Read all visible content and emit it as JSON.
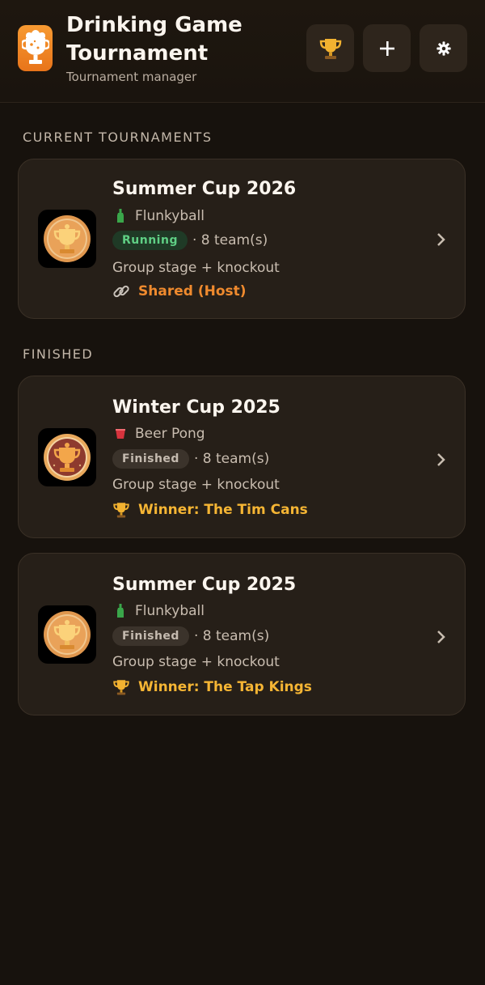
{
  "header": {
    "title": "Drinking Game Tournament",
    "subtitle": "Tournament manager",
    "icons": {
      "app": "beer-trophy-icon",
      "trophy": "trophy-icon",
      "add": "plus-icon",
      "settings": "gear-icon"
    }
  },
  "sections": {
    "current": "CURRENT TOURNAMENTS",
    "finished": "FINISHED"
  },
  "tournaments": [
    {
      "title": "Summer Cup 2026",
      "game": "Flunkyball",
      "game_icon": "bottle-icon",
      "status": "Running",
      "teams": "· 8 team(s)",
      "format": "Group stage + knockout",
      "note": "Shared (Host)",
      "note_icon": "link-icon",
      "note_color": "#ef8a2e"
    },
    {
      "title": "Winter Cup 2025",
      "game": "Beer Pong",
      "game_icon": "red-cup-icon",
      "status": "Finished",
      "teams": "· 8 team(s)",
      "format": "Group stage + knockout",
      "note": "Winner: The Tim Cans",
      "note_icon": "trophy-icon",
      "note_color": "#f5b534"
    },
    {
      "title": "Summer Cup 2025",
      "game": "Flunkyball",
      "game_icon": "bottle-icon",
      "status": "Finished",
      "teams": "· 8 team(s)",
      "format": "Group stage + knockout",
      "note": "Winner: The Tap Kings",
      "note_icon": "trophy-icon",
      "note_color": "#f5b534"
    }
  ],
  "colors": {
    "background": "#17120d",
    "card": "#261f18",
    "accent_orange": "#ef8a2e",
    "winner_gold": "#f5b534",
    "running_green": "#5fcf84"
  }
}
